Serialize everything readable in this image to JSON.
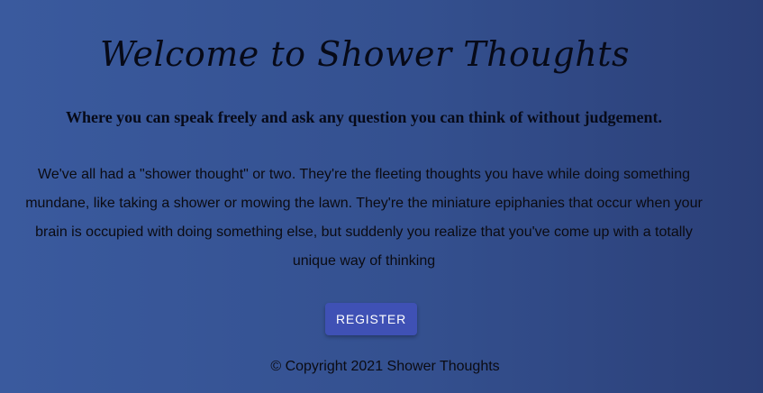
{
  "title": "Welcome to Shower Thoughts",
  "subtitle": "Where you can speak freely and ask any question you can think of without judgement.",
  "description": "We've all had a \"shower thought\" or two. They're the fleeting thoughts you have while doing something mundane, like taking a shower or mowing the lawn. They're the miniature epiphanies that occur when your brain is occupied with doing something else, but suddenly you realize that you've come up with a totally unique way of thinking",
  "register_button": "REGISTER",
  "footer": "© Copyright 2021 Shower Thoughts",
  "colors": {
    "background_start": "#3a5a9e",
    "background_end": "#2b3f77",
    "button": "#3f51b5",
    "button_text": "#ffffff"
  }
}
